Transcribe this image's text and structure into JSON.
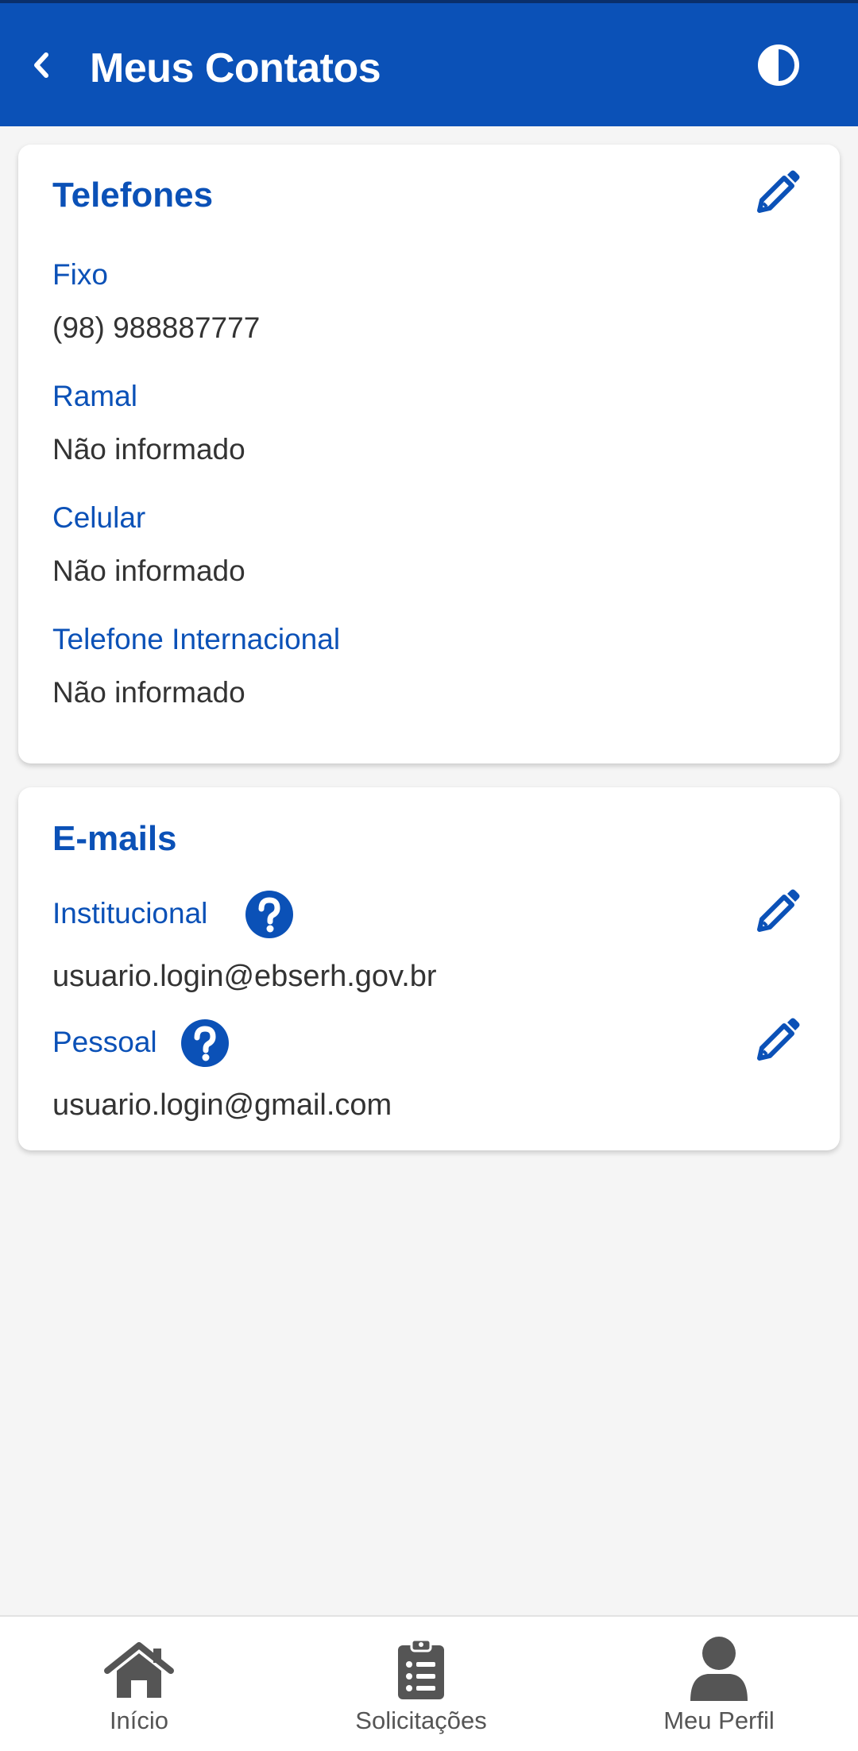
{
  "header": {
    "title": "Meus Contatos",
    "back_icon": "chevron-left-icon",
    "contrast_icon": "contrast-icon"
  },
  "phones": {
    "title": "Telefones",
    "edit_icon": "pencil-icon",
    "items": [
      {
        "label": "Fixo",
        "value": "(98) 988887777"
      },
      {
        "label": "Ramal",
        "value": "Não informado"
      },
      {
        "label": "Celular",
        "value": "Não informado"
      },
      {
        "label": "Telefone Internacional",
        "value": "Não informado"
      }
    ]
  },
  "emails": {
    "title": "E-mails",
    "items": [
      {
        "label": "Institucional",
        "value": "usuario.login@ebserh.gov.br",
        "help_icon": "question-circle-icon",
        "edit_icon": "pencil-icon"
      },
      {
        "label": "Pessoal",
        "value": "usuario.login@gmail.com",
        "help_icon": "question-circle-icon",
        "edit_icon": "pencil-icon"
      }
    ]
  },
  "bottom_nav": {
    "items": [
      {
        "label": "Início",
        "icon": "home-icon"
      },
      {
        "label": "Solicitações",
        "icon": "clipboard-list-icon"
      },
      {
        "label": "Meu Perfil",
        "icon": "user-icon"
      }
    ]
  },
  "colors": {
    "primary": "#0b51b7",
    "background": "#f5f5f5",
    "text": "#333333",
    "nav_icon": "#555555"
  }
}
